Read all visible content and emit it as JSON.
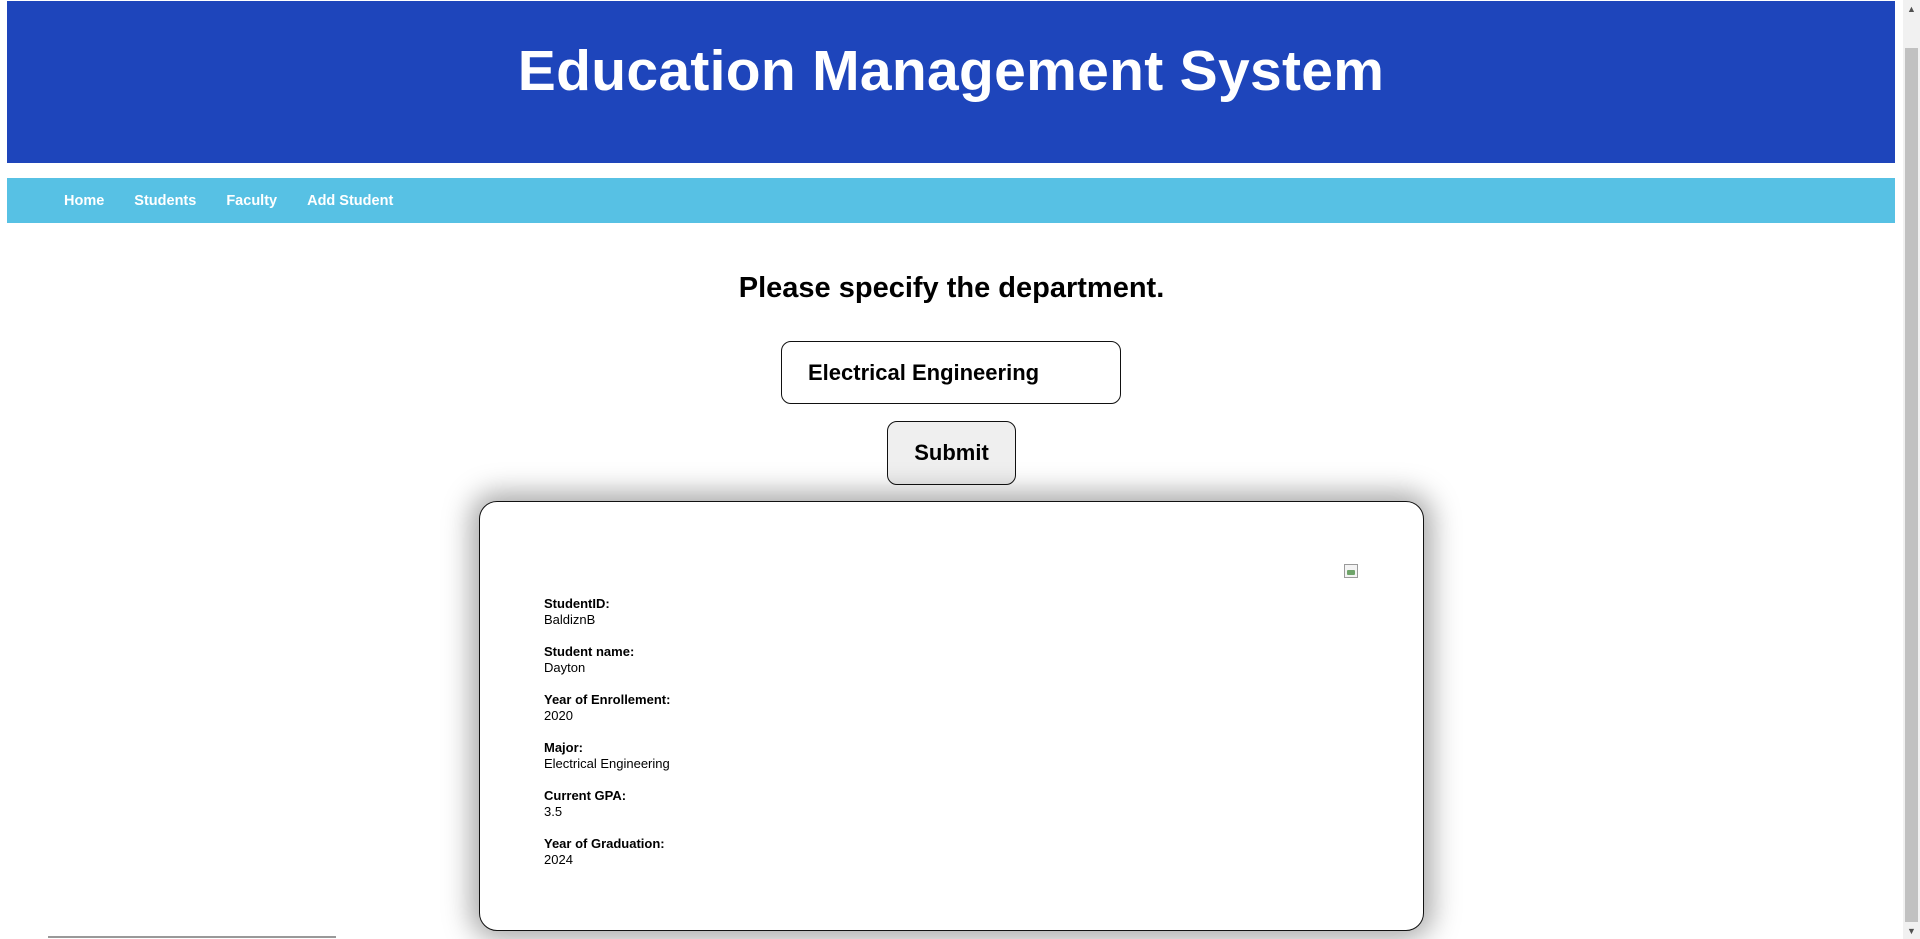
{
  "header": {
    "title": "Education Management System"
  },
  "nav": {
    "items": [
      {
        "label": "Home"
      },
      {
        "label": "Students"
      },
      {
        "label": "Faculty"
      },
      {
        "label": "Add Student"
      }
    ]
  },
  "main": {
    "prompt": "Please specify the department.",
    "department_input": {
      "value": "Electrical Engineering"
    },
    "submit_label": "Submit"
  },
  "student_card": {
    "photo_icon": "broken-image-icon",
    "fields": [
      {
        "label": "StudentID:",
        "value": "BaldiznB"
      },
      {
        "label": "Student name:",
        "value": "Dayton"
      },
      {
        "label": "Year of Enrollement:",
        "value": "2020"
      },
      {
        "label": "Major:",
        "value": "Electrical Engineering"
      },
      {
        "label": "Current GPA:",
        "value": "3.5"
      },
      {
        "label": "Year of Graduation:",
        "value": "2024"
      }
    ]
  },
  "colors": {
    "header_bg": "#1e45bb",
    "nav_bg": "#57c1e4"
  }
}
